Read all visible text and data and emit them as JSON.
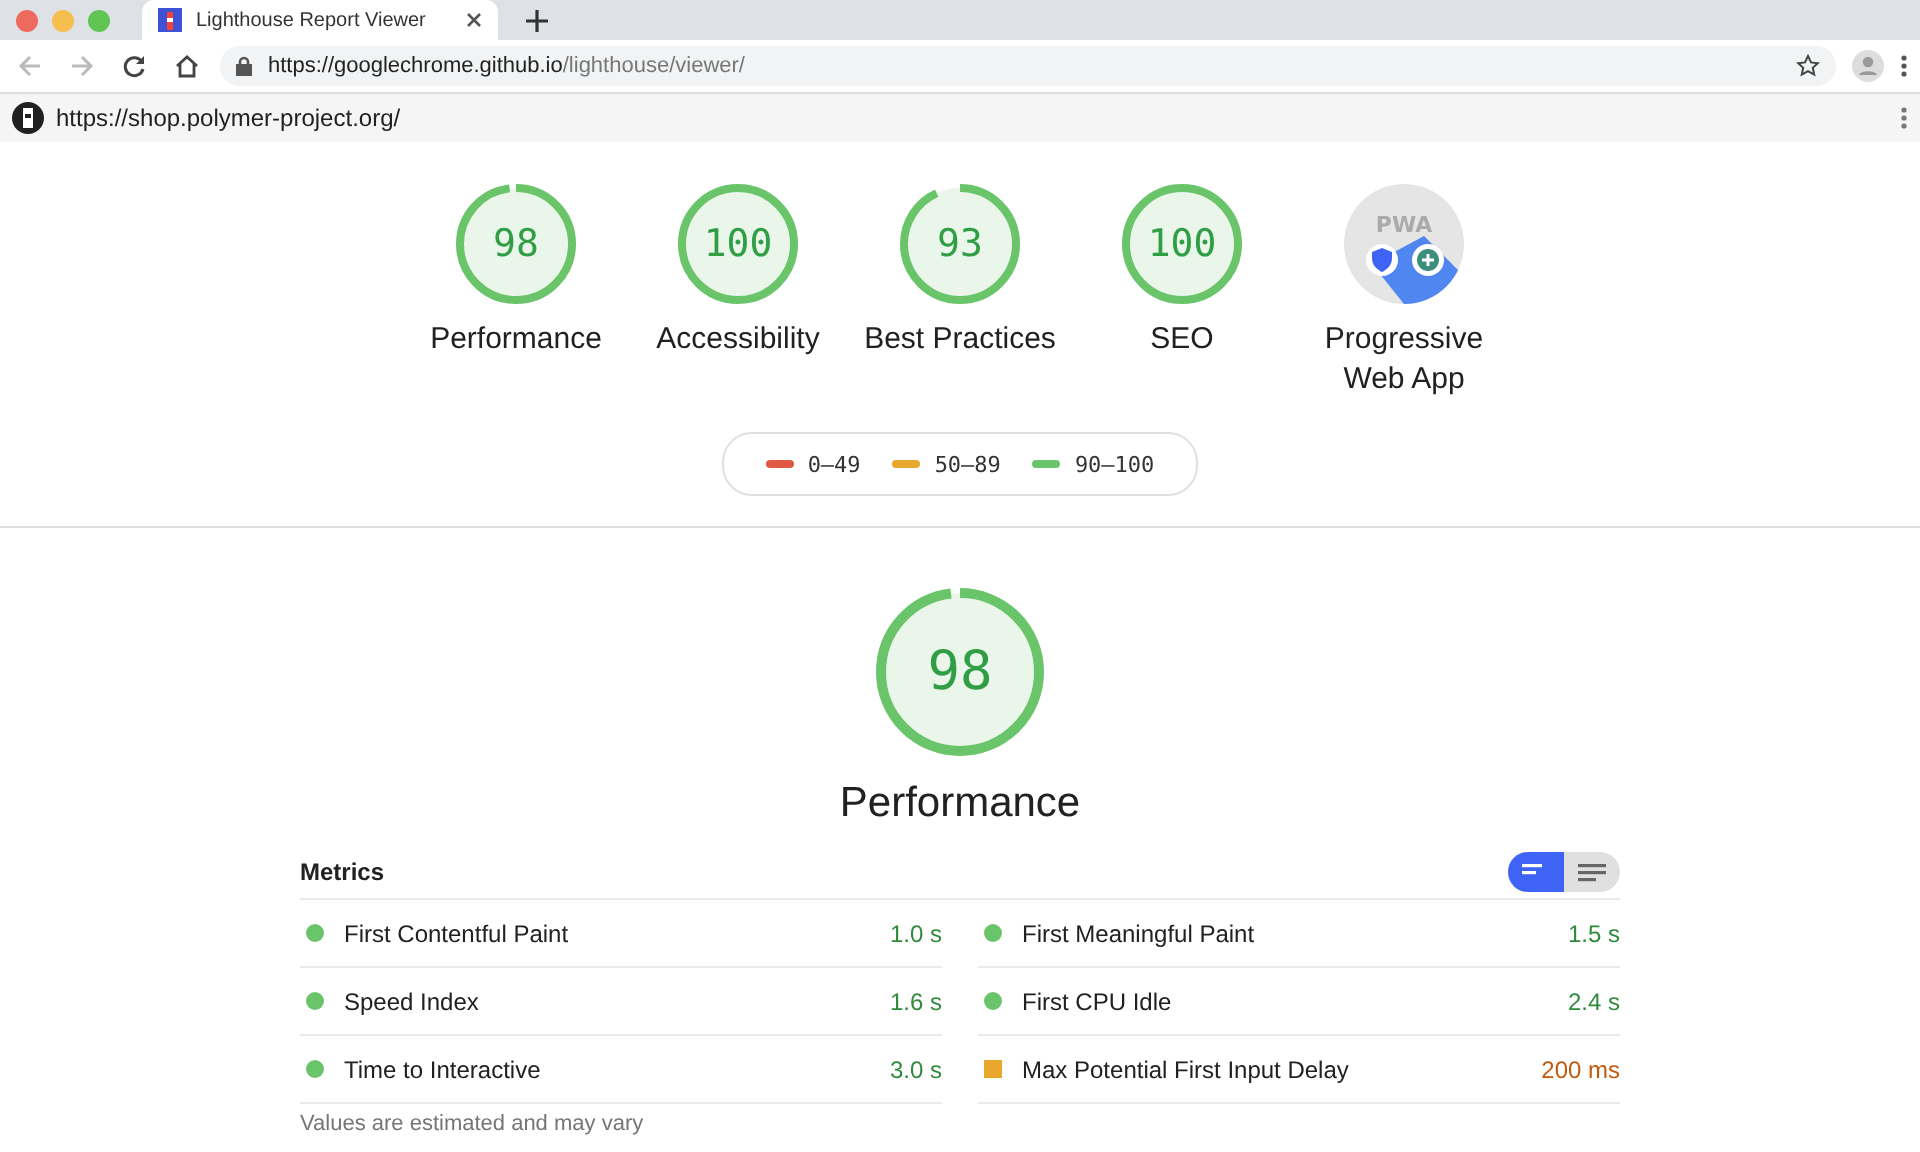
{
  "browser": {
    "tab": {
      "title": "Lighthouse Report Viewer",
      "selected": true
    },
    "address": {
      "host": "https://googlechrome.github.io",
      "path": "/lighthouse/viewer/"
    }
  },
  "report_bar": {
    "url": "https://shop.polymer-project.org/"
  },
  "categories": [
    {
      "kind": "gauge",
      "score": "98",
      "level": 0.98,
      "label": "Performance"
    },
    {
      "kind": "gauge",
      "score": "100",
      "level": 1,
      "label": "Accessibility"
    },
    {
      "kind": "gauge",
      "score": "93",
      "level": 0.93,
      "label": "Best Practices"
    },
    {
      "kind": "gauge",
      "score": "100",
      "level": 1,
      "label": "SEO"
    },
    {
      "kind": "badge",
      "label": "Progressive Web App",
      "badge_text": "PWA"
    }
  ],
  "legend": [
    {
      "label": "0–49",
      "color": "#e05a43"
    },
    {
      "label": "50–89",
      "color": "#e9a72b"
    },
    {
      "label": "90–100",
      "color": "#6ac46a"
    }
  ],
  "section": {
    "score": "98",
    "level": 0.98,
    "title": "Performance"
  },
  "metrics": {
    "title": "Metrics",
    "view_toggle": [
      {
        "selected": true
      },
      {
        "selected": false
      }
    ],
    "items": [
      {
        "name": "First Contentful Paint",
        "value": "1.0 s",
        "kind": "pass",
        "color": "#6ac46a"
      },
      {
        "name": "First Meaningful Paint",
        "value": "1.5 s",
        "kind": "pass",
        "color": "#6ac46a"
      },
      {
        "name": "Speed Index",
        "value": "1.6 s",
        "kind": "pass",
        "color": "#6ac46a"
      },
      {
        "name": "First CPU Idle",
        "value": "2.4 s",
        "kind": "pass",
        "color": "#6ac46a"
      },
      {
        "name": "Time to Interactive",
        "value": "3.0 s",
        "kind": "pass",
        "color": "#6ac46a"
      },
      {
        "name": "Max Potential First Input Delay",
        "value": "200 ms",
        "kind": "average",
        "color": "#e9a72b"
      }
    ],
    "note": "Values are estimated and may vary"
  }
}
